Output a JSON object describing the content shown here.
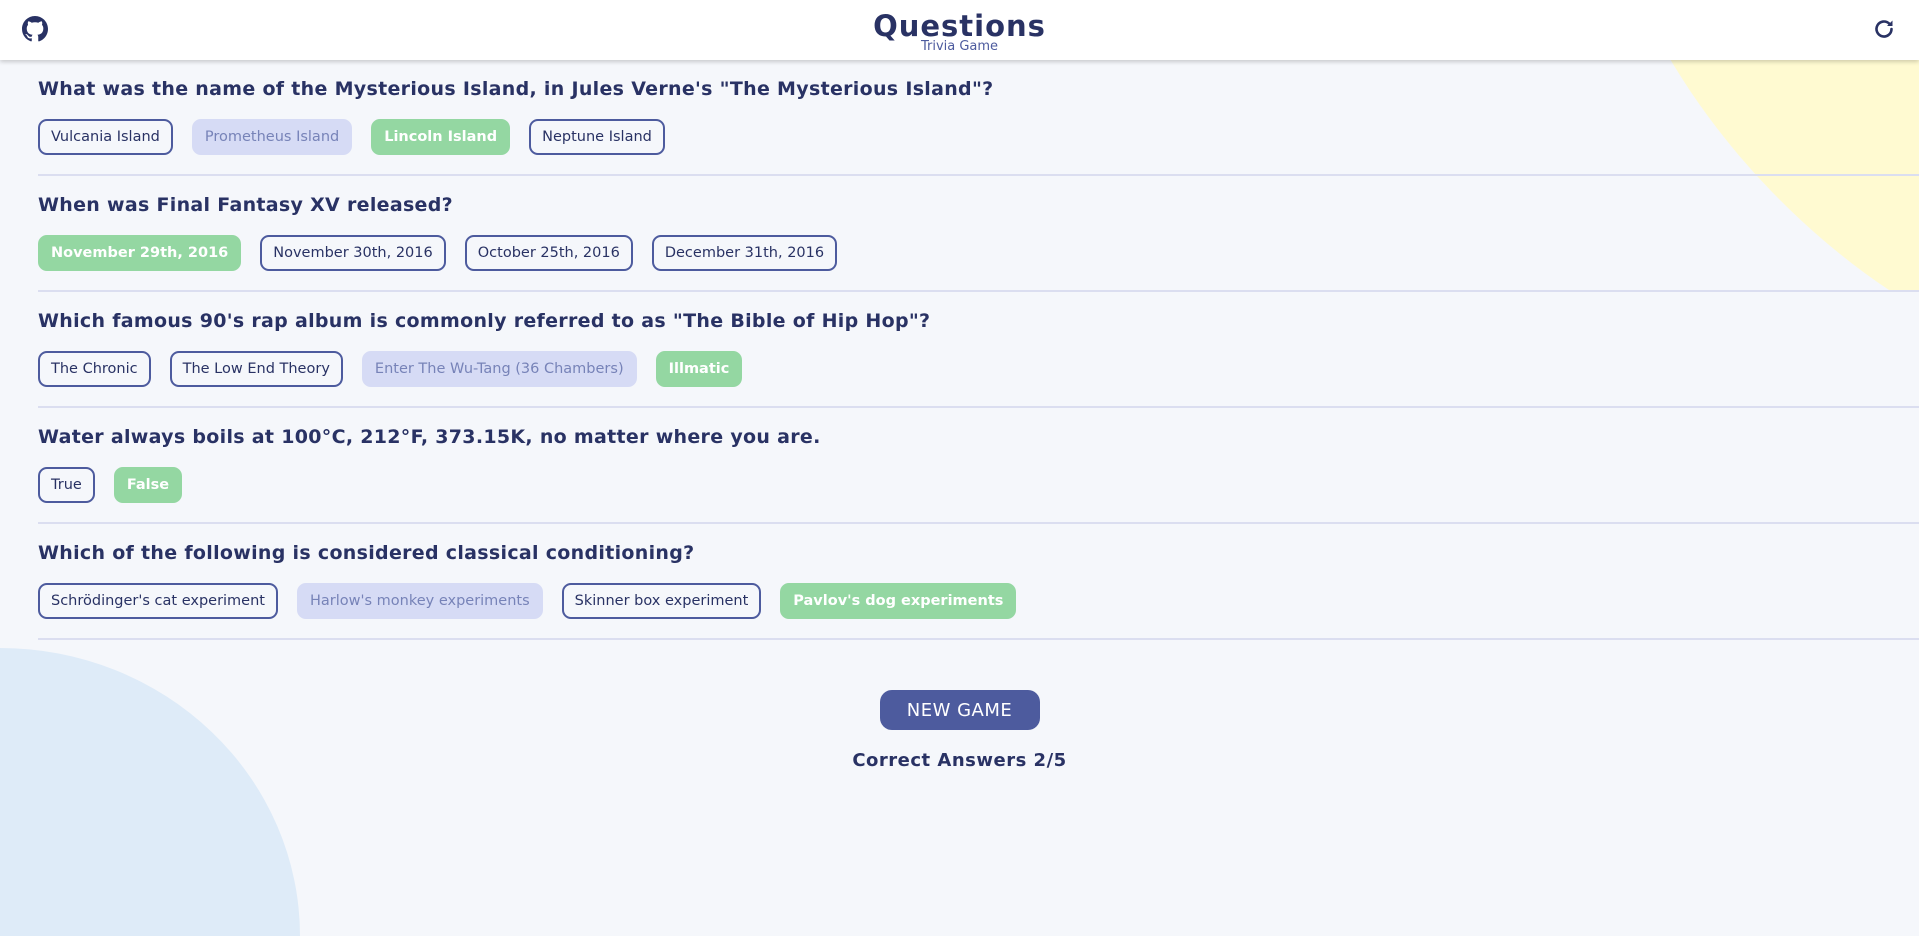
{
  "header": {
    "title": "Questions",
    "subtitle": "Trivia Game",
    "left_icon": "github-icon",
    "right_icon": "refresh-icon"
  },
  "questions": [
    {
      "text": "What was the name of the Mysterious Island, in Jules Verne's \"The Mysterious Island\"?",
      "answers": [
        {
          "label": "Vulcania Island",
          "state": "default"
        },
        {
          "label": "Prometheus Island",
          "state": "wrong"
        },
        {
          "label": "Lincoln Island",
          "state": "correct"
        },
        {
          "label": "Neptune Island",
          "state": "default"
        }
      ]
    },
    {
      "text": "When was Final Fantasy XV released?",
      "answers": [
        {
          "label": "November 29th, 2016",
          "state": "correct"
        },
        {
          "label": "November 30th, 2016",
          "state": "default"
        },
        {
          "label": "October 25th, 2016",
          "state": "default"
        },
        {
          "label": "December 31th, 2016",
          "state": "default"
        }
      ]
    },
    {
      "text": "Which famous 90's rap album is commonly referred to as \"The Bible of Hip Hop\"?",
      "answers": [
        {
          "label": "The Chronic",
          "state": "default"
        },
        {
          "label": "The Low End Theory",
          "state": "default"
        },
        {
          "label": "Enter The Wu-Tang (36 Chambers)",
          "state": "wrong"
        },
        {
          "label": "Illmatic",
          "state": "correct"
        }
      ]
    },
    {
      "text": "Water always boils at 100°C, 212°F, 373.15K, no matter where you are.",
      "answers": [
        {
          "label": "True",
          "state": "default"
        },
        {
          "label": "False",
          "state": "correct"
        }
      ]
    },
    {
      "text": "Which of the following is considered classical conditioning?",
      "answers": [
        {
          "label": "Schrödinger's cat experiment",
          "state": "default"
        },
        {
          "label": "Harlow's monkey experiments",
          "state": "wrong"
        },
        {
          "label": "Skinner box experiment",
          "state": "default"
        },
        {
          "label": "Pavlov's dog experiments",
          "state": "correct"
        }
      ]
    }
  ],
  "footer": {
    "new_game_label": "NEW GAME",
    "score_text": "Correct Answers 2/5"
  },
  "colors": {
    "background": "#f5f7fb",
    "text": "#293264",
    "accent": "#4d5b9e",
    "correct": "#94d7a2",
    "wrong": "#d6dbf5",
    "blob_yellow": "#fffad1",
    "blob_blue": "#deebf8"
  }
}
